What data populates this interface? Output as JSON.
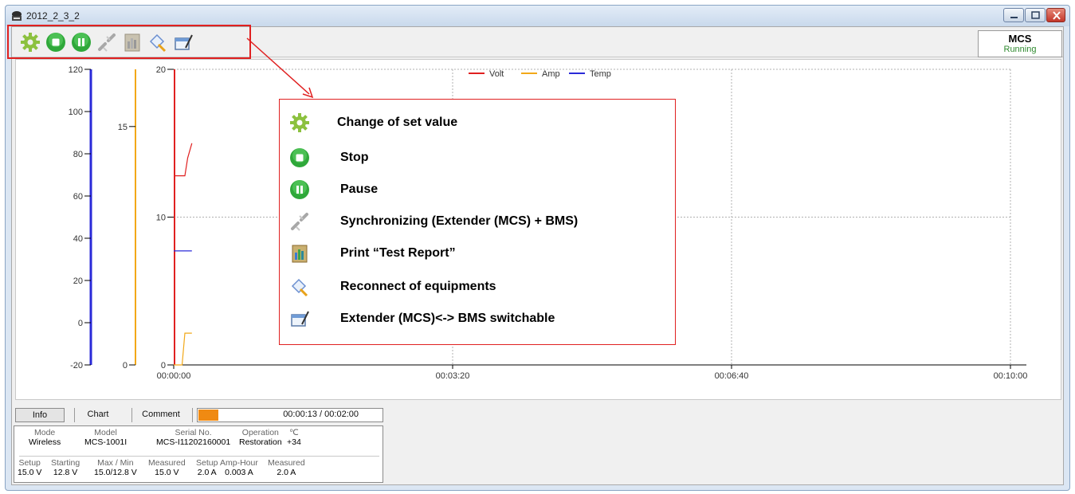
{
  "window": {
    "title": "2012_2_3_2"
  },
  "status": {
    "title": "MCS",
    "value": "Running"
  },
  "toolbar": {
    "buttons": [
      "gear-icon",
      "stop-icon",
      "pause-icon",
      "sync-icon",
      "print-icon",
      "reconnect-icon",
      "switch-icon"
    ]
  },
  "chart_data": {
    "type": "line",
    "legend": [
      "Volt",
      "Amp",
      "Temp"
    ],
    "colors": {
      "Volt": "#e02020",
      "Amp": "#f2a818",
      "Temp": "#2a2ad8"
    },
    "x_ticks": [
      "00:00:00",
      "00:03:20",
      "00:06:40",
      "00:10:00"
    ],
    "y_axes": [
      {
        "ticks": [
          "120",
          "100",
          "80",
          "60",
          "40",
          "20",
          "0",
          "-20"
        ],
        "color": "#2a2ad8"
      },
      {
        "ticks": [
          "15",
          "0"
        ],
        "color": "#f2a818"
      },
      {
        "ticks": [
          "20",
          "10",
          "0"
        ],
        "color": "#e02020"
      }
    ],
    "series": [
      {
        "name": "Volt",
        "x": [
          "00:00:00",
          "00:00:08",
          "00:00:10",
          "00:00:13"
        ],
        "y": [
          12.8,
          12.8,
          14.0,
          15.0
        ]
      },
      {
        "name": "Temp",
        "x": [
          "00:00:00",
          "00:00:13"
        ],
        "y": [
          34,
          34
        ]
      },
      {
        "name": "Amp",
        "x": [
          "00:00:00",
          "00:00:06",
          "00:00:08",
          "00:00:13"
        ],
        "y": [
          0,
          0,
          2.0,
          2.0
        ]
      }
    ]
  },
  "legend_items": [
    {
      "icon": "gear-icon",
      "label": "Change of set value"
    },
    {
      "icon": "stop-icon",
      "label": "Stop"
    },
    {
      "icon": "pause-icon",
      "label": "Pause"
    },
    {
      "icon": "sync-icon",
      "label": "Synchronizing (Extender (MCS) + BMS)"
    },
    {
      "icon": "print-icon",
      "label": "Print “Test Report”"
    },
    {
      "icon": "reconnect-icon",
      "label": "Reconnect of equipments"
    },
    {
      "icon": "switch-icon",
      "label": "Extender (MCS)<-> BMS switchable"
    }
  ],
  "tabs": {
    "info": "Info",
    "chart": "Chart",
    "comment": "Comment"
  },
  "progress": {
    "text": "00:00:13 / 00:02:00",
    "fraction": 0.108
  },
  "info": {
    "row1": [
      {
        "h": "Mode",
        "v": "Wireless"
      },
      {
        "h": "Model",
        "v": "MCS-1001I"
      },
      {
        "h": "Serial No.",
        "v": "MCS-I11202160001"
      },
      {
        "h": "Operation",
        "v": "Restoration"
      },
      {
        "h": "℃",
        "v": "+34"
      }
    ],
    "row2": [
      {
        "h": "Setup",
        "v": "15.0 V"
      },
      {
        "h": "Starting",
        "v": "12.8 V"
      },
      {
        "h": "Max / Min",
        "v": "15.0/12.8 V"
      },
      {
        "h": "Measured",
        "v": "15.0 V"
      },
      {
        "h": "Setup",
        "v": "2.0 A"
      },
      {
        "h": "Amp-Hour",
        "v": "0.003 A"
      },
      {
        "h": "Measured",
        "v": "2.0 A"
      }
    ]
  }
}
